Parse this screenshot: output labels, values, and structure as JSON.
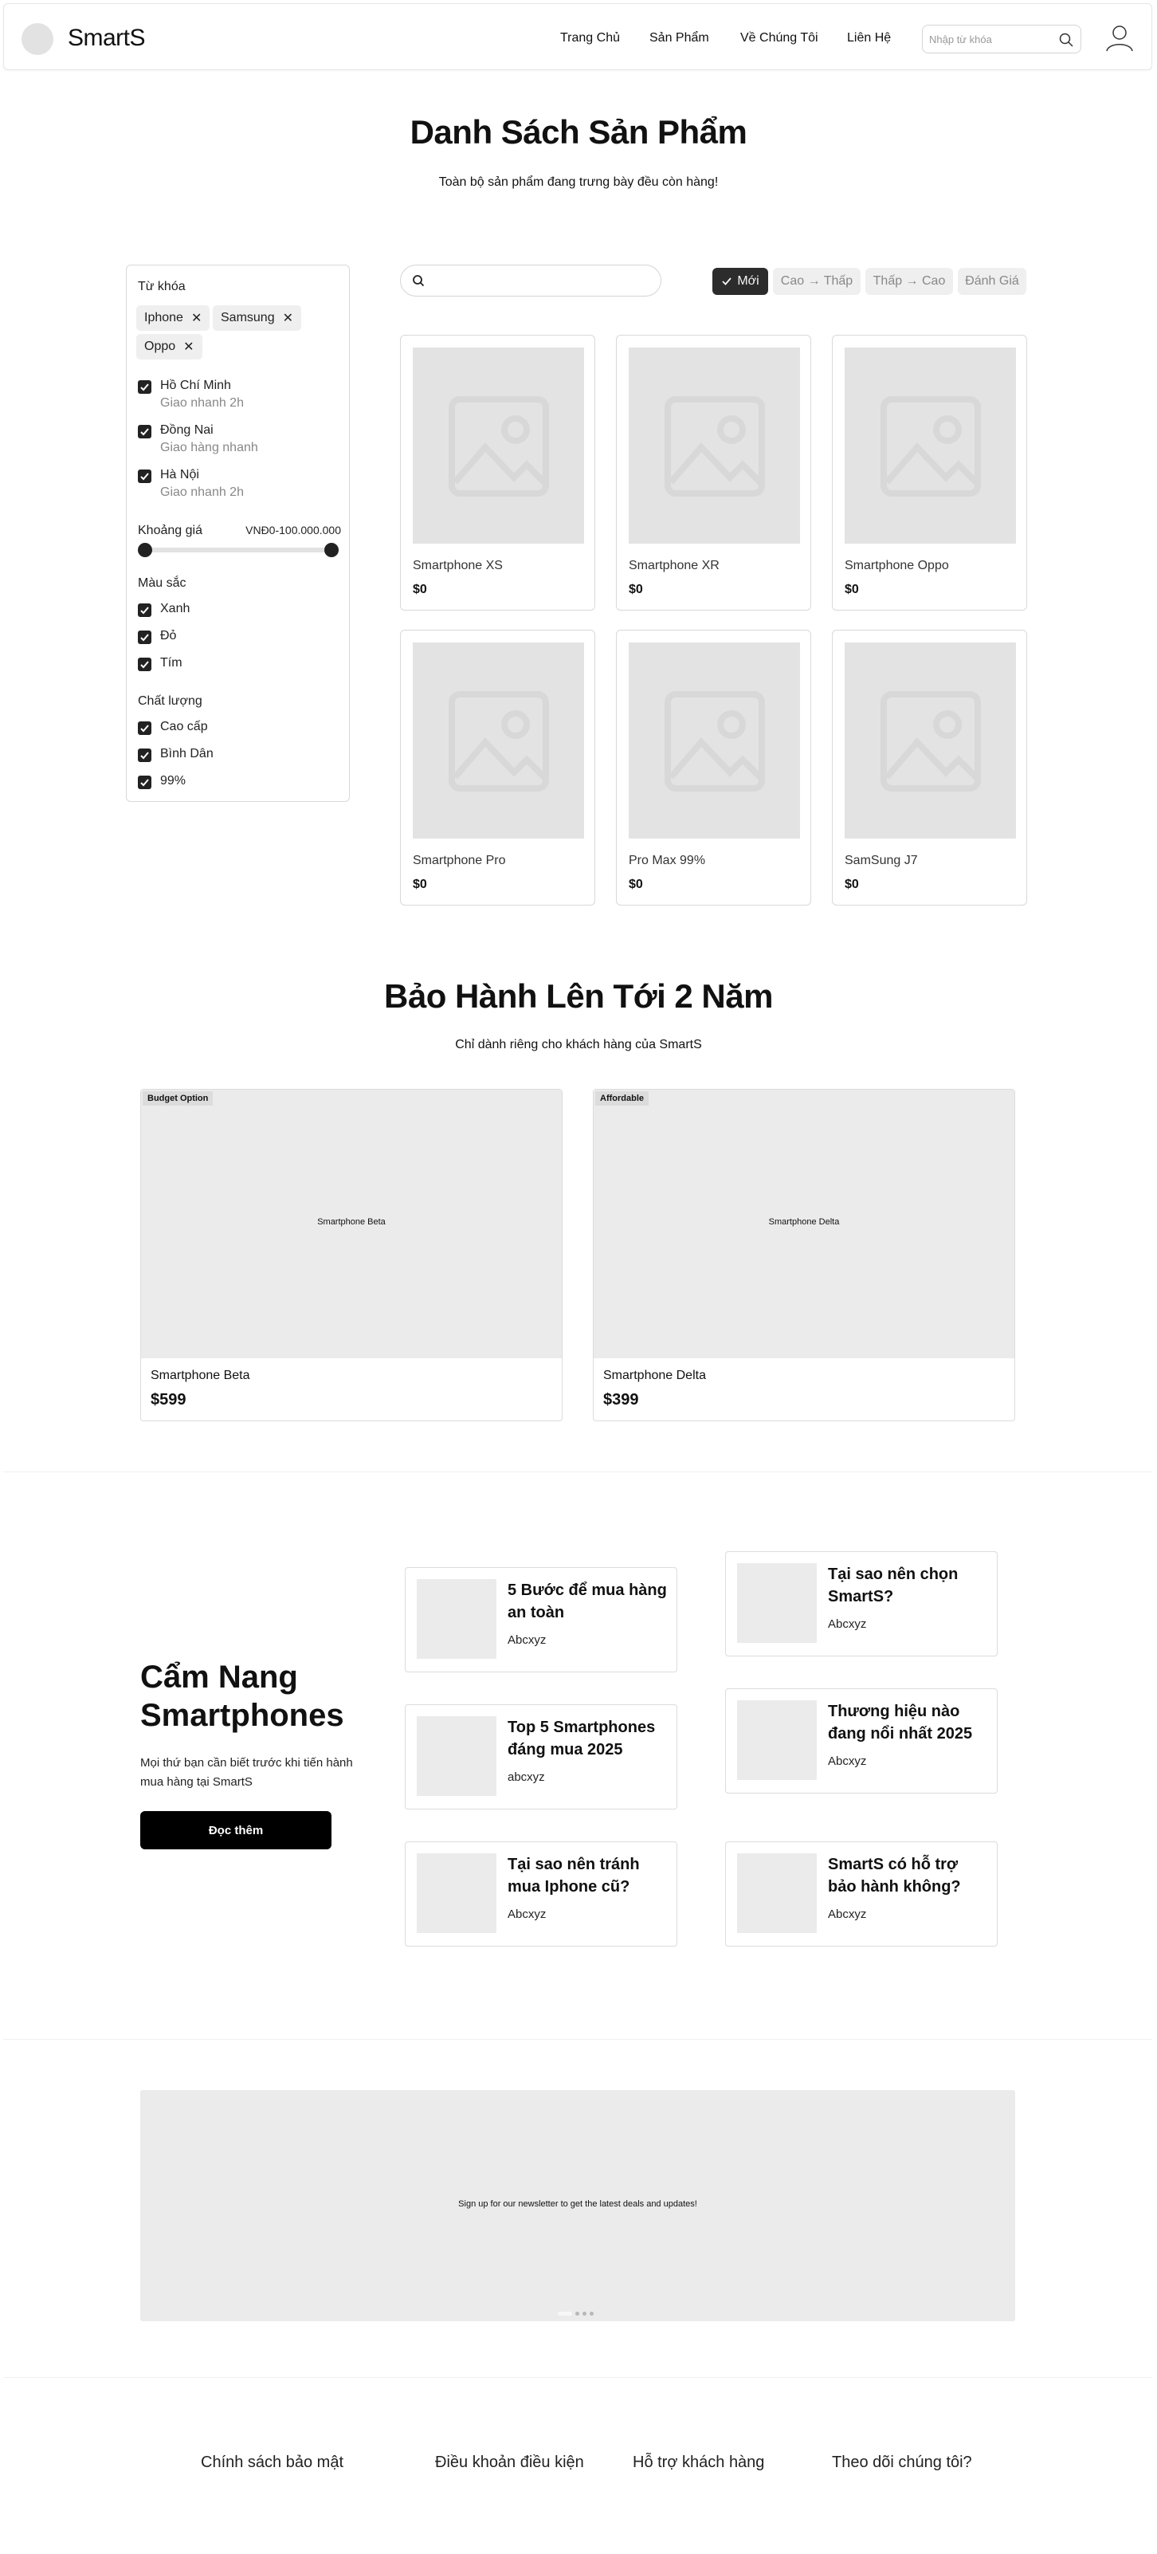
{
  "header": {
    "brand": "SmartS",
    "nav": [
      "Trang Chủ",
      "Sản Phẩm",
      "Về Chúng Tôi",
      "Liên Hệ"
    ],
    "search_placeholder": "Nhập từ khóa"
  },
  "products_section": {
    "title": "Danh Sách Sản Phẩm",
    "subtitle": "Toàn bộ sản phẩm đang trưng bày đều còn hàng!"
  },
  "filters": {
    "keyword_title": "Từ khóa",
    "chips": [
      "Iphone",
      "Samsung",
      "Oppo"
    ],
    "locations": [
      {
        "name": "Hồ Chí Minh",
        "note": "Giao nhanh 2h",
        "checked": true
      },
      {
        "name": "Đồng Nai",
        "note": "Giao hàng nhanh",
        "checked": true
      },
      {
        "name": "Hà Nội",
        "note": "Giao nhanh 2h",
        "checked": true
      }
    ],
    "price_title": "Khoảng giá",
    "price_range": "VNĐ0-100.000.000",
    "color_title": "Màu sắc",
    "colors": [
      {
        "name": "Xanh",
        "checked": true
      },
      {
        "name": "Đỏ",
        "checked": true
      },
      {
        "name": "Tím",
        "checked": true
      }
    ],
    "quality_title": "Chất lượng",
    "qualities": [
      {
        "name": "Cao cấp",
        "checked": true
      },
      {
        "name": "Bình Dân",
        "checked": true
      },
      {
        "name": "99%",
        "checked": true
      }
    ]
  },
  "sort": {
    "options": [
      "Mới",
      "Cao → Thấp",
      "Thấp → Cao",
      "Đánh Giá"
    ],
    "active": "Mới"
  },
  "products": [
    {
      "name": "Smartphone XS",
      "price": "$0"
    },
    {
      "name": "Smartphone XR",
      "price": "$0"
    },
    {
      "name": "Smartphone Oppo",
      "price": "$0"
    },
    {
      "name": "Smartphone Pro",
      "price": "$0"
    },
    {
      "name": "Pro Max 99%",
      "price": "$0"
    },
    {
      "name": "SamSung J7",
      "price": "$0"
    }
  ],
  "warranty": {
    "title": "Bảo Hành Lên Tới 2 Năm",
    "subtitle": "Chỉ dành riêng cho khách hàng của SmartS",
    "cards": [
      {
        "badge": "Budget Option",
        "image_caption": "Smartphone Beta",
        "name": "Smartphone Beta",
        "price": "$599"
      },
      {
        "badge": "Affordable",
        "image_caption": "Smartphone Delta",
        "name": "Smartphone Delta",
        "price": "$399"
      }
    ]
  },
  "guide": {
    "title_line1": "Cẩm Nang",
    "title_line2": "Smartphones",
    "description": "Mọi thứ bạn cần biết trước khi tiến hành mua hàng tại SmartS",
    "button": "Đọc thêm",
    "articles": [
      {
        "title": "5 Bước để mua hàng an toàn",
        "author": "Abcxyz"
      },
      {
        "title": "Tại sao nên chọn SmartS?",
        "author": "Abcxyz"
      },
      {
        "title": "Top 5 Smartphones đáng mua 2025",
        "author": "abcxyz"
      },
      {
        "title": "Thương hiệu nào đang nổi nhất 2025",
        "author": "Abcxyz"
      },
      {
        "title": "Tại sao nên tránh mua Iphone cũ?",
        "author": "Abcxyz"
      },
      {
        "title": "SmartS có hỗ trợ bảo hành không?",
        "author": "Abcxyz"
      }
    ]
  },
  "newsletter": {
    "text": "Sign up for our newsletter to get the latest deals and updates!",
    "slide_count": 4,
    "active_slide": 1
  },
  "footer": {
    "links": [
      "Chính sách bảo mật",
      "Điều khoản điều kiện",
      "Hỗ trợ khách hàng",
      "Theo dõi chúng tôi?"
    ]
  },
  "colors": {
    "accent_dark": "#2c2c2c",
    "button_black": "#000000",
    "placeholder_gray": "#e3e3e3"
  }
}
